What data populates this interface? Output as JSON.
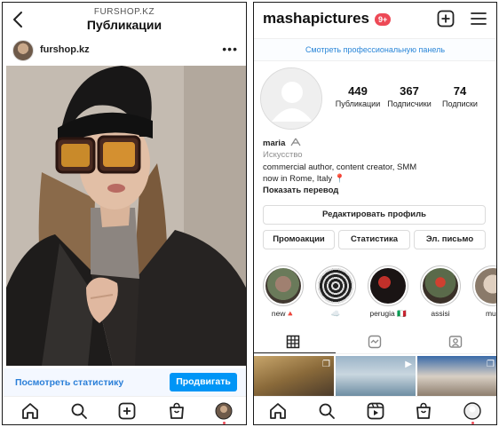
{
  "left": {
    "header": {
      "subtitle": "FURSHOP.KZ",
      "title": "Публикации"
    },
    "post": {
      "username": "furshop.kz",
      "more": "•••"
    },
    "stats_bar": {
      "link": "Посмотреть статистику",
      "button": "Продвигать"
    },
    "tabbar": [
      "home-icon",
      "search-icon",
      "add-icon",
      "shop-icon",
      "profile-icon"
    ]
  },
  "right": {
    "header": {
      "username": "mashapictures",
      "badge": "9+"
    },
    "pro_panel": "Смотреть профессиональную панель",
    "stats": [
      {
        "num": "449",
        "label": "Публикации"
      },
      {
        "num": "367",
        "label": "Подписчики"
      },
      {
        "num": "74",
        "label": "Подписки"
      }
    ],
    "bio": {
      "name": "maria",
      "category": "Искусство",
      "line1": "commercial author, content creator, SMM",
      "line2": "now in Rome, Italy 📍",
      "translate": "Показать перевод"
    },
    "buttons": {
      "edit_profile": "Редактировать профиль",
      "promotions": "Промоакции",
      "insights": "Статистика",
      "email": "Эл. письмо"
    },
    "stories": [
      {
        "label": "new🔺"
      },
      {
        "label": "☁️"
      },
      {
        "label": "perugia 🇮🇹"
      },
      {
        "label": "assisi"
      },
      {
        "label": "mus"
      }
    ],
    "grid_tabs": [
      "grid-icon",
      "reels-icon",
      "tagged-icon"
    ],
    "tabbar": [
      "home-icon",
      "search-icon",
      "reels-icon",
      "shop-icon",
      "profile-icon"
    ]
  }
}
